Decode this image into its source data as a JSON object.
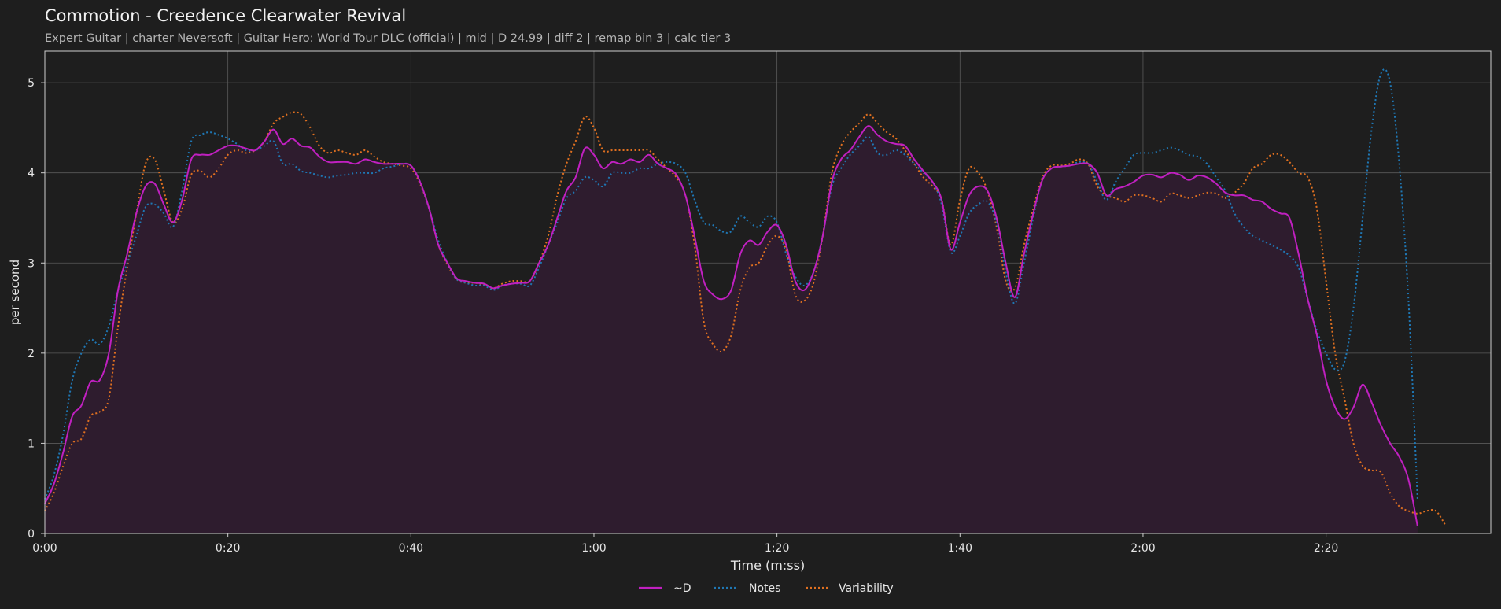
{
  "title": "Commotion - Creedence Clearwater Revival",
  "subtitle": "Expert Guitar  |  charter Neversoft  |  Guitar Hero: World Tour DLC (official)  |  mid  |  D 24.99  |  diff 2  |  remap bin 3  |  calc tier 3",
  "colors": {
    "background": "#1e1e1e",
    "d": "#c020c0",
    "notes": "#1f77b4",
    "variability": "#e07020",
    "fill": "#2e1c2e",
    "grid": "#5a5a5a"
  },
  "chart_data": {
    "type": "line",
    "xlabel": "Time (m:ss)",
    "ylabel": "per second",
    "xlim": [
      0,
      158
    ],
    "ylim": [
      0,
      5.35
    ],
    "grid": true,
    "legend_position": "bottom-center",
    "x_ticks": [
      0,
      20,
      40,
      60,
      80,
      100,
      120,
      140
    ],
    "x_tick_labels": [
      "0:00",
      "0:20",
      "0:40",
      "1:00",
      "1:20",
      "1:40",
      "2:00",
      "2:20"
    ],
    "y_ticks": [
      0,
      1,
      2,
      3,
      4,
      5
    ],
    "y_tick_labels": [
      "0",
      "1",
      "2",
      "3",
      "4",
      "5"
    ],
    "x": [
      0,
      1,
      2,
      3,
      4,
      5,
      6,
      7,
      8,
      9,
      10,
      11,
      12,
      13,
      14,
      15,
      16,
      17,
      18,
      19,
      20,
      21,
      22,
      23,
      24,
      25,
      26,
      27,
      28,
      29,
      30,
      31,
      32,
      33,
      34,
      35,
      36,
      37,
      38,
      39,
      40,
      41,
      42,
      43,
      44,
      45,
      46,
      47,
      48,
      49,
      50,
      51,
      52,
      53,
      54,
      55,
      56,
      57,
      58,
      59,
      60,
      61,
      62,
      63,
      64,
      65,
      66,
      67,
      68,
      69,
      70,
      71,
      72,
      73,
      74,
      75,
      76,
      77,
      78,
      79,
      80,
      81,
      82,
      83,
      84,
      85,
      86,
      87,
      88,
      89,
      90,
      91,
      92,
      93,
      94,
      95,
      96,
      97,
      98,
      99,
      100,
      101,
      102,
      103,
      104,
      105,
      106,
      107,
      108,
      109,
      110,
      111,
      112,
      113,
      114,
      115,
      116,
      117,
      118,
      119,
      120,
      121,
      122,
      123,
      124,
      125,
      126,
      127,
      128,
      129,
      130,
      131,
      132,
      133,
      134,
      135,
      136,
      137,
      138,
      139,
      140,
      141,
      142,
      143,
      144,
      145,
      146,
      147,
      148,
      149,
      150,
      151,
      152,
      153,
      154,
      155,
      156,
      157,
      158
    ],
    "series": [
      {
        "name": "~D",
        "style": "solid",
        "values": [
          0.33,
          0.55,
          0.9,
          1.3,
          1.42,
          1.68,
          1.7,
          2.0,
          2.7,
          3.1,
          3.55,
          3.85,
          3.88,
          3.65,
          3.45,
          3.7,
          4.15,
          4.2,
          4.2,
          4.25,
          4.3,
          4.3,
          4.27,
          4.25,
          4.35,
          4.48,
          4.32,
          4.38,
          4.3,
          4.28,
          4.18,
          4.12,
          4.12,
          4.12,
          4.1,
          4.15,
          4.12,
          4.1,
          4.1,
          4.1,
          4.08,
          3.9,
          3.6,
          3.2,
          3.0,
          2.83,
          2.8,
          2.78,
          2.77,
          2.72,
          2.75,
          2.77,
          2.78,
          2.8,
          3.0,
          3.2,
          3.5,
          3.8,
          3.95,
          4.27,
          4.2,
          4.05,
          4.12,
          4.1,
          4.15,
          4.12,
          4.2,
          4.1,
          4.05,
          3.98,
          3.75,
          3.3,
          2.8,
          2.65,
          2.6,
          2.7,
          3.1,
          3.25,
          3.2,
          3.35,
          3.42,
          3.2,
          2.8,
          2.7,
          2.9,
          3.3,
          3.9,
          4.15,
          4.25,
          4.4,
          4.52,
          4.42,
          4.35,
          4.32,
          4.3,
          4.15,
          4.02,
          3.9,
          3.7,
          3.15,
          3.45,
          3.75,
          3.85,
          3.8,
          3.5,
          3.0,
          2.62,
          3.1,
          3.55,
          3.92,
          4.05,
          4.07,
          4.08,
          4.1,
          4.1,
          4.0,
          3.75,
          3.82,
          3.85,
          3.9,
          3.97,
          3.98,
          3.95,
          4.0,
          3.98,
          3.92,
          3.97,
          3.95,
          3.88,
          3.78,
          3.75,
          3.75,
          3.7,
          3.68,
          3.6,
          3.55,
          3.5,
          3.1,
          2.6,
          2.2,
          1.7,
          1.4,
          1.27,
          1.4,
          1.65,
          1.45,
          1.2,
          1.0,
          0.85,
          0.6,
          0.08
        ]
      },
      {
        "name": "Notes",
        "style": "dotted",
        "values": [
          0.38,
          0.65,
          1.1,
          1.7,
          2.0,
          2.15,
          2.1,
          2.3,
          2.7,
          3.0,
          3.3,
          3.62,
          3.65,
          3.55,
          3.4,
          3.8,
          4.35,
          4.42,
          4.45,
          4.42,
          4.38,
          4.32,
          4.25,
          4.25,
          4.3,
          4.35,
          4.1,
          4.1,
          4.02,
          4.0,
          3.97,
          3.95,
          3.97,
          3.98,
          4.0,
          4.0,
          4.0,
          4.05,
          4.07,
          4.1,
          4.08,
          3.9,
          3.6,
          3.25,
          3.0,
          2.82,
          2.78,
          2.75,
          2.75,
          2.7,
          2.75,
          2.77,
          2.77,
          2.75,
          2.95,
          3.2,
          3.45,
          3.72,
          3.8,
          3.95,
          3.92,
          3.85,
          4.0,
          4.0,
          4.0,
          4.05,
          4.05,
          4.1,
          4.12,
          4.1,
          4.0,
          3.7,
          3.45,
          3.42,
          3.35,
          3.35,
          3.52,
          3.45,
          3.4,
          3.52,
          3.45,
          3.1,
          2.85,
          2.75,
          2.9,
          3.3,
          3.85,
          4.05,
          4.2,
          4.3,
          4.4,
          4.22,
          4.2,
          4.25,
          4.2,
          4.1,
          4.0,
          3.9,
          3.65,
          3.12,
          3.3,
          3.55,
          3.65,
          3.68,
          3.45,
          2.9,
          2.55,
          3.0,
          3.5,
          3.92,
          4.05,
          4.07,
          4.08,
          4.12,
          4.1,
          3.9,
          3.7,
          3.9,
          4.05,
          4.2,
          4.22,
          4.22,
          4.25,
          4.28,
          4.25,
          4.2,
          4.18,
          4.1,
          3.95,
          3.8,
          3.55,
          3.4,
          3.3,
          3.25,
          3.2,
          3.15,
          3.08,
          2.95,
          2.6,
          2.25,
          2.0,
          1.82,
          1.9,
          2.5,
          3.5,
          4.5,
          5.1,
          5.0,
          4.1,
          2.6,
          0.38
        ]
      },
      {
        "name": "Variability",
        "style": "dotted",
        "values": [
          0.25,
          0.45,
          0.75,
          1.0,
          1.05,
          1.3,
          1.35,
          1.5,
          2.3,
          2.95,
          3.55,
          4.1,
          4.15,
          3.8,
          3.45,
          3.6,
          3.98,
          4.02,
          3.95,
          4.05,
          4.2,
          4.25,
          4.22,
          4.25,
          4.35,
          4.55,
          4.62,
          4.67,
          4.65,
          4.5,
          4.3,
          4.22,
          4.25,
          4.22,
          4.2,
          4.25,
          4.18,
          4.12,
          4.1,
          4.08,
          4.05,
          3.88,
          3.6,
          3.2,
          2.98,
          2.82,
          2.78,
          2.78,
          2.76,
          2.72,
          2.77,
          2.8,
          2.8,
          2.8,
          3.0,
          3.3,
          3.75,
          4.1,
          4.35,
          4.62,
          4.5,
          4.25,
          4.25,
          4.25,
          4.25,
          4.25,
          4.25,
          4.15,
          4.05,
          3.95,
          3.75,
          3.2,
          2.35,
          2.1,
          2.02,
          2.2,
          2.7,
          2.95,
          3.0,
          3.2,
          3.3,
          3.15,
          2.65,
          2.58,
          2.78,
          3.3,
          4.0,
          4.3,
          4.45,
          4.55,
          4.65,
          4.55,
          4.45,
          4.38,
          4.25,
          4.1,
          3.95,
          3.85,
          3.7,
          3.2,
          3.7,
          4.05,
          4.0,
          3.8,
          3.4,
          2.8,
          2.72,
          3.2,
          3.6,
          3.95,
          4.08,
          4.08,
          4.1,
          4.15,
          4.1,
          3.85,
          3.75,
          3.72,
          3.68,
          3.75,
          3.75,
          3.72,
          3.68,
          3.77,
          3.75,
          3.72,
          3.75,
          3.78,
          3.77,
          3.72,
          3.78,
          3.88,
          4.05,
          4.1,
          4.2,
          4.2,
          4.12,
          4.0,
          3.95,
          3.6,
          2.8,
          2.0,
          1.5,
          1.0,
          0.75,
          0.7,
          0.68,
          0.45,
          0.3,
          0.25,
          0.22,
          0.25,
          0.25,
          0.1
        ]
      }
    ]
  }
}
